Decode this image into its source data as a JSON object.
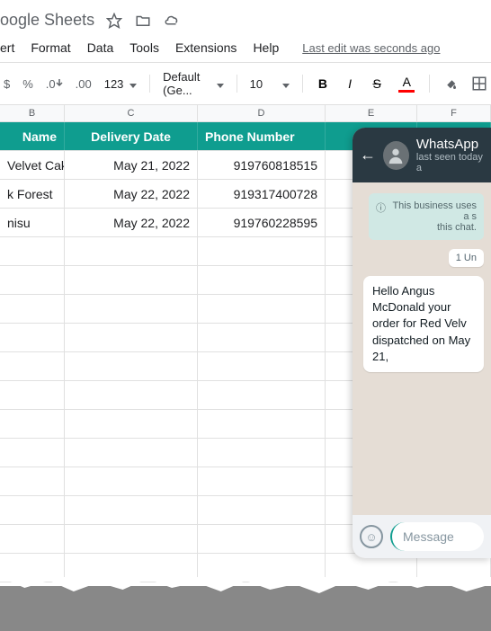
{
  "titlebar": {
    "app_name": "oogle Sheets"
  },
  "menubar": {
    "items": [
      "ert",
      "Format",
      "Data",
      "Tools",
      "Extensions",
      "Help"
    ],
    "last_edit": "Last edit was seconds ago"
  },
  "toolbar": {
    "currency": "$",
    "percent": "%",
    "dec_dec": ".0",
    "inc_dec": ".00",
    "num_format": "123",
    "font": "Default (Ge...",
    "font_size": "10",
    "bold": "B",
    "italic": "I",
    "strike": "S",
    "text_color": "A"
  },
  "columns": [
    "B",
    "C",
    "D",
    "E",
    "F"
  ],
  "header_row": {
    "name": "Name",
    "delivery_date": "Delivery Date",
    "phone": "Phone Number"
  },
  "rows": [
    {
      "name": "Velvet Cake",
      "date": "May 21, 2022",
      "phone": "919760818515"
    },
    {
      "name": "k Forest",
      "date": "May 22, 2022",
      "phone": "919317400728"
    },
    {
      "name": "nisu",
      "date": "May 22, 2022",
      "phone": "919760228595"
    }
  ],
  "whatsapp": {
    "title": "WhatsApp",
    "status": "last seen today a",
    "biz_notice": "This business uses a s\nthis chat.",
    "unread": "1 Un",
    "message": "Hello Angus McDonald your order for Red Velv dispatched on May 21,",
    "input_placeholder": "Message"
  }
}
